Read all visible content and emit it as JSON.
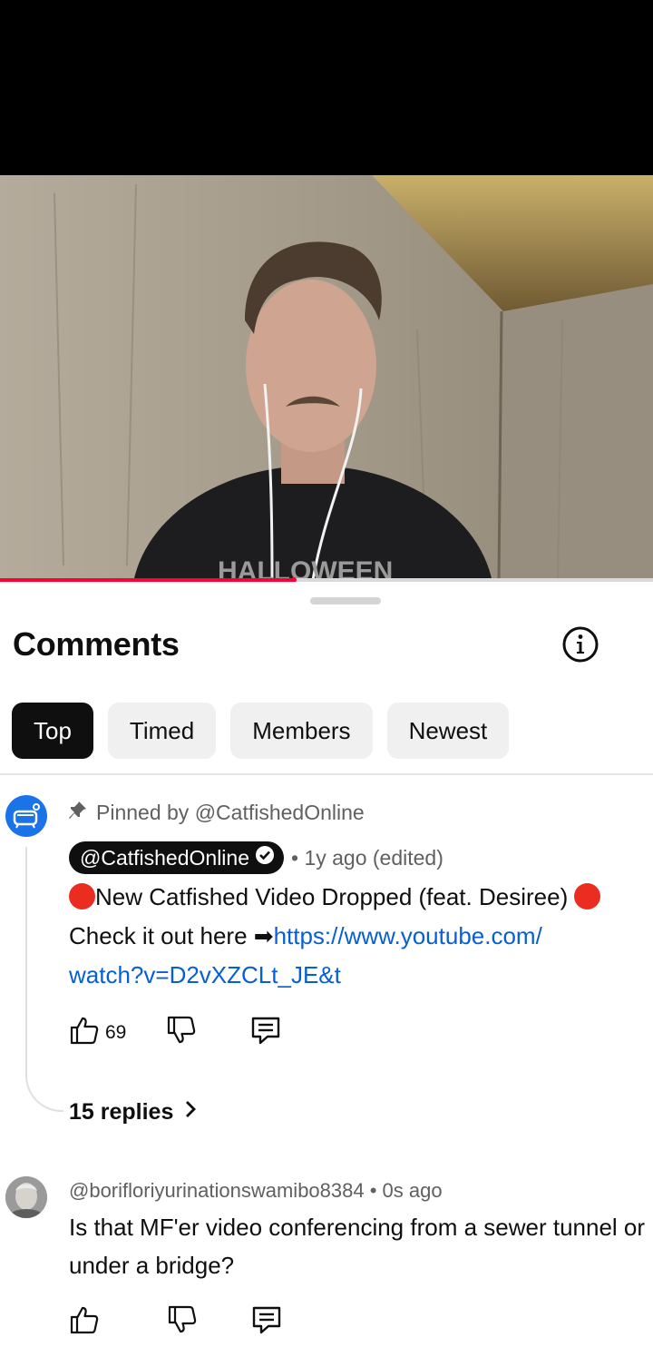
{
  "video": {
    "shirt_text": "HALLOWEEN",
    "progress_fraction": 0.45
  },
  "comments_sheet": {
    "title": "Comments",
    "info_icon": "info-icon",
    "filters": [
      {
        "label": "Top",
        "active": true
      },
      {
        "label": "Timed",
        "active": false
      },
      {
        "label": "Members",
        "active": false
      },
      {
        "label": "Newest",
        "active": false
      }
    ]
  },
  "pinned_comment": {
    "pinned_label": "Pinned by @CatfishedOnline",
    "author": "@CatfishedOnline",
    "verified_icon": "verified-check-icon",
    "meta": "• 1y ago (edited)",
    "line1": "New Catfished Video Dropped (feat. Desiree)",
    "line2_prefix": "Check it out here ➡",
    "link_part1": "https://www.youtube.com/",
    "link_part2": "watch?v=D2vXZCLt_JE&t",
    "likes": "69",
    "replies_label": "15 replies"
  },
  "second_comment": {
    "author": "@borifloriyurinationswamibo8384",
    "meta": "• 0s ago",
    "text": "Is that MF'er video conferencing from a sewer tunnel or under a bridge?"
  },
  "colors": {
    "accent_red": "#ff0033",
    "link_blue": "#065fd4",
    "chip_active_bg": "#0f0f0f",
    "chip_bg": "#f0f0f0"
  }
}
